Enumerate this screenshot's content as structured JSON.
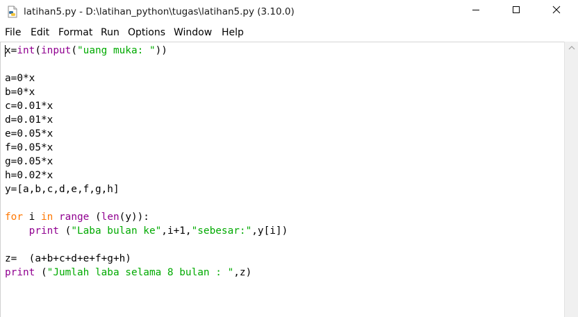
{
  "window": {
    "title": "latihan5.py - D:\\latihan_python\\tugas\\latihan5.py (3.10.0)",
    "app_icon": "python-file-icon",
    "controls": {
      "minimize": "minimize-icon",
      "maximize": "maximize-icon",
      "close": "close-icon"
    }
  },
  "menubar": {
    "items": [
      {
        "label": "File"
      },
      {
        "label": "Edit"
      },
      {
        "label": "Format"
      },
      {
        "label": "Run"
      },
      {
        "label": "Options"
      },
      {
        "label": "Window"
      },
      {
        "label": "Help"
      }
    ]
  },
  "editor": {
    "lines": [
      {
        "tokens": [
          {
            "t": "x="
          },
          {
            "t": "int",
            "c": "builtin"
          },
          {
            "t": "("
          },
          {
            "t": "input",
            "c": "builtin"
          },
          {
            "t": "("
          },
          {
            "t": "\"uang muka: \"",
            "c": "string"
          },
          {
            "t": "))"
          }
        ]
      },
      {
        "tokens": []
      },
      {
        "tokens": [
          {
            "t": "a=0*x"
          }
        ]
      },
      {
        "tokens": [
          {
            "t": "b=0*x"
          }
        ]
      },
      {
        "tokens": [
          {
            "t": "c=0.01*x"
          }
        ]
      },
      {
        "tokens": [
          {
            "t": "d=0.01*x"
          }
        ]
      },
      {
        "tokens": [
          {
            "t": "e=0.05*x"
          }
        ]
      },
      {
        "tokens": [
          {
            "t": "f=0.05*x"
          }
        ]
      },
      {
        "tokens": [
          {
            "t": "g=0.05*x"
          }
        ]
      },
      {
        "tokens": [
          {
            "t": "h=0.02*x"
          }
        ]
      },
      {
        "tokens": [
          {
            "t": "y=[a,b,c,d,e,f,g,h]"
          }
        ]
      },
      {
        "tokens": []
      },
      {
        "tokens": [
          {
            "t": "for",
            "c": "keyword"
          },
          {
            "t": " i "
          },
          {
            "t": "in",
            "c": "keyword"
          },
          {
            "t": " "
          },
          {
            "t": "range",
            "c": "builtin"
          },
          {
            "t": " ("
          },
          {
            "t": "len",
            "c": "builtin"
          },
          {
            "t": "(y)):"
          }
        ]
      },
      {
        "tokens": [
          {
            "t": "    "
          },
          {
            "t": "print",
            "c": "builtin"
          },
          {
            "t": " ("
          },
          {
            "t": "\"Laba bulan ke\"",
            "c": "string"
          },
          {
            "t": ",i+1,"
          },
          {
            "t": "\"sebesar:\"",
            "c": "string"
          },
          {
            "t": ",y[i])"
          }
        ]
      },
      {
        "tokens": []
      },
      {
        "tokens": [
          {
            "t": "z=  (a+b+c+d+e+f+g+h)"
          }
        ]
      },
      {
        "tokens": [
          {
            "t": "print",
            "c": "builtin"
          },
          {
            "t": " ("
          },
          {
            "t": "\"Jumlah laba selama 8 bulan : \"",
            "c": "string"
          },
          {
            "t": ",z)"
          }
        ]
      }
    ]
  },
  "scrollbar": {
    "up_arrow": "chevron-up-icon"
  },
  "colors": {
    "builtin": "#900090",
    "string": "#00aa00",
    "keyword": "#ff7700",
    "default": "#000000"
  }
}
